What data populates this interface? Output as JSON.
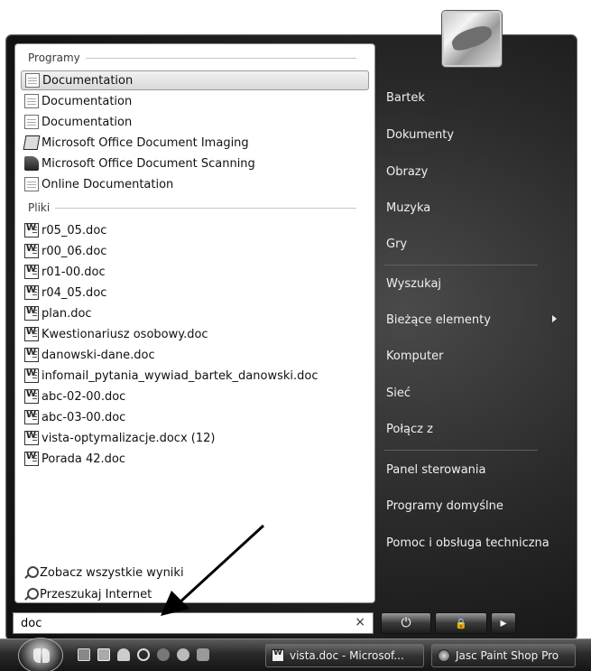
{
  "left_pane": {
    "programs_header": "Programy",
    "programs": [
      {
        "label": "Documentation",
        "icon": "document-page-icon",
        "selected": true
      },
      {
        "label": "Documentation",
        "icon": "document-page-icon",
        "selected": false
      },
      {
        "label": "Documentation",
        "icon": "document-page-icon",
        "selected": false
      },
      {
        "label": "Microsoft Office Document Imaging",
        "icon": "office-imaging-icon",
        "selected": false
      },
      {
        "label": "Microsoft Office Document Scanning",
        "icon": "office-scanning-icon",
        "selected": false
      },
      {
        "label": "Online Documentation",
        "icon": "document-page-icon",
        "selected": false
      }
    ],
    "files_header": "Pliki",
    "files": [
      {
        "label": "r05_05.doc",
        "icon": "word-document-icon"
      },
      {
        "label": "r00_06.doc",
        "icon": "word-document-icon"
      },
      {
        "label": "r01-00.doc",
        "icon": "word-document-icon"
      },
      {
        "label": "r04_05.doc",
        "icon": "word-document-icon"
      },
      {
        "label": "plan.doc",
        "icon": "word-document-icon"
      },
      {
        "label": "Kwestionariusz osobowy.doc",
        "icon": "word-document-icon"
      },
      {
        "label": "danowski-dane.doc",
        "icon": "word-document-icon"
      },
      {
        "label": "infomail_pytania_wywiad_bartek_danowski.doc",
        "icon": "word-document-icon"
      },
      {
        "label": "abc-02-00.doc",
        "icon": "word-document-icon"
      },
      {
        "label": "abc-03-00.doc",
        "icon": "word-document-icon"
      },
      {
        "label": "vista-optymalizacje.docx (12)",
        "icon": "word-document-icon"
      },
      {
        "label": "Porada 42.doc",
        "icon": "word-document-icon"
      }
    ],
    "see_all": "Zobacz wszystkie wyniki",
    "search_internet": "Przeszukaj Internet"
  },
  "search": {
    "value": "doc",
    "clear_glyph": "×"
  },
  "right_pane": {
    "items": [
      "Bartek",
      "Dokumenty",
      "Obrazy",
      "Muzyka",
      "Gry",
      "Wyszukaj",
      "Bieżące elementy",
      "Komputer",
      "Sieć",
      "Połącz z",
      "Panel sterowania",
      "Programy domyślne",
      "Pomoc i obsługa techniczna"
    ]
  },
  "power": {
    "power_glyph": "⏻",
    "lock_glyph": "🔒",
    "options_glyph": "▸"
  },
  "taskbar": {
    "tasks": [
      "vista.doc - Microsof...",
      "Jasc Paint Shop Pro"
    ]
  },
  "colors": {
    "menu_background": "#1e1e1e",
    "right_text": "#f0f0f0",
    "selection": "#d8d8d8"
  }
}
